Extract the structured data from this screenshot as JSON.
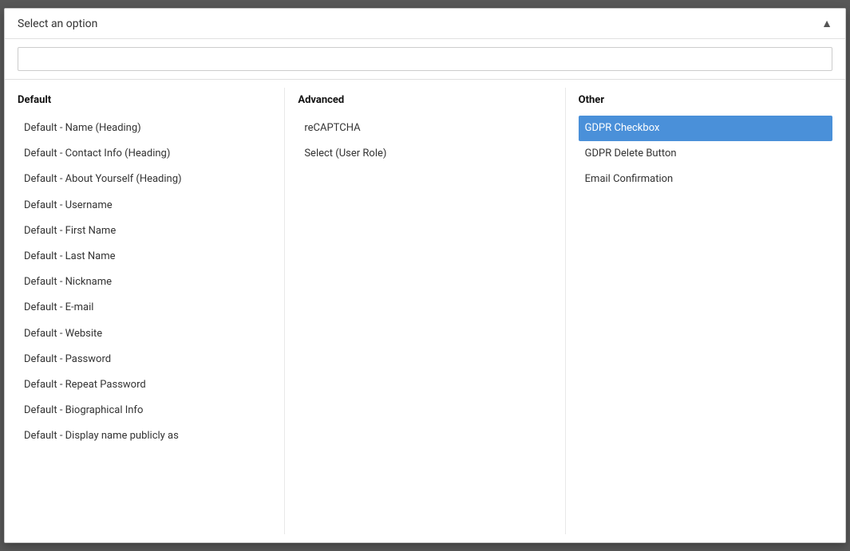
{
  "dropdown": {
    "title": "Select an option",
    "search_placeholder": "",
    "columns": {
      "default": {
        "header": "Default",
        "items": [
          "Default - Name (Heading)",
          "Default - Contact Info (Heading)",
          "Default - About Yourself (Heading)",
          "Default - Username",
          "Default - First Name",
          "Default - Last Name",
          "Default - Nickname",
          "Default - E-mail",
          "Default - Website",
          "Default - Password",
          "Default - Repeat Password",
          "Default - Biographical Info",
          "Default - Display name publicly as"
        ]
      },
      "advanced": {
        "header": "Advanced",
        "items": [
          "reCAPTCHA",
          "Select (User Role)"
        ]
      },
      "other": {
        "header": "Other",
        "items": [
          "GDPR Checkbox",
          "GDPR Delete Button",
          "Email Confirmation"
        ],
        "selected_index": 0
      }
    }
  }
}
